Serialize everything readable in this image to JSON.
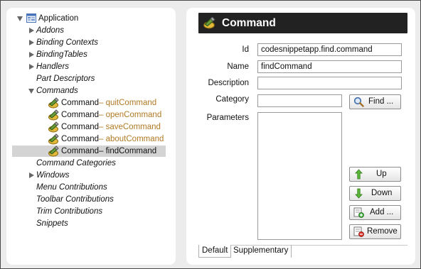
{
  "tree": {
    "root_label": "Application",
    "items": [
      {
        "label": "Addons",
        "expandable": true
      },
      {
        "label": "Binding Contexts",
        "expandable": true
      },
      {
        "label": "BindingTables",
        "expandable": true
      },
      {
        "label": "Handlers",
        "expandable": true
      },
      {
        "label": "Part Descriptors",
        "expandable": false
      },
      {
        "label": "Commands",
        "expandable": true,
        "expanded": true
      }
    ],
    "commands": [
      {
        "name": "Command",
        "suffix": " – quitCommand"
      },
      {
        "name": "Command",
        "suffix": " – openCommand"
      },
      {
        "name": "Command",
        "suffix": " – saveCommand"
      },
      {
        "name": "Command",
        "suffix": " – aboutCommand"
      },
      {
        "name": "Command",
        "suffix": " – findCommand",
        "selected": true
      }
    ],
    "items_after": [
      {
        "label": "Command Categories",
        "expandable": false
      },
      {
        "label": "Windows",
        "expandable": true
      },
      {
        "label": "Menu Contributions",
        "expandable": false
      },
      {
        "label": "Toolbar Contributions",
        "expandable": false
      },
      {
        "label": "Trim Contributions",
        "expandable": false
      },
      {
        "label": "Snippets",
        "expandable": false
      }
    ]
  },
  "form": {
    "title": "Command",
    "id_label": "Id",
    "id_value": "codesnippetapp.find.command",
    "name_label": "Name",
    "name_value": "findCommand",
    "description_label": "Description",
    "description_value": "",
    "category_label": "Category",
    "category_value": "",
    "find_button": "Find ...",
    "parameters_label": "Parameters",
    "up_button": "Up",
    "down_button": "Down",
    "add_button": "Add ...",
    "remove_button": "Remove"
  },
  "tabs": [
    {
      "label": "Default",
      "active": true
    },
    {
      "label": "Supplementary",
      "active": false
    }
  ],
  "colors": {
    "command_suffix": "#b07a24",
    "title_bar": "#222222",
    "selection": "#d4d4d4"
  }
}
